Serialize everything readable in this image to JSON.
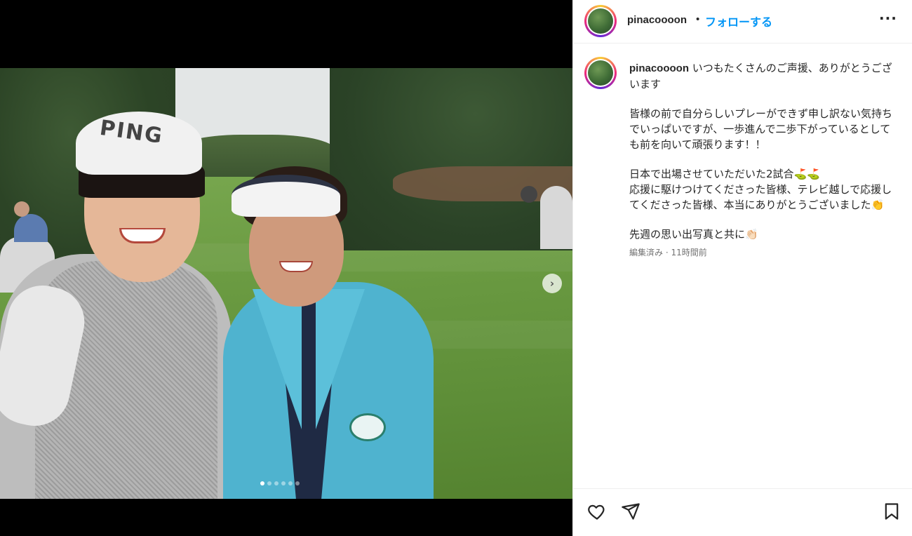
{
  "post": {
    "username": "pinacoooon",
    "separator": "•",
    "follow_label": "フォローする",
    "more_label": "···",
    "caption_first_line": "いつもたくさんのご声援、ありがとうございます",
    "caption_para2": "皆様の前で自分らしいプレーができず申し訳ない気持ちでいっぱいですが、一歩進んで二歩下がっているとしても前を向いて頑張ります！！",
    "caption_para3": "日本で出場させていただいた2試合⛳⛳\n応援に駆けつけてくださった皆様、テレビ越しで応援してくださった皆様、本当にありがとうございました👏",
    "caption_para4": "先週の思い出写真と共に👏🏻",
    "meta": "編集済み · 11時間前",
    "cap_text": "PING"
  },
  "carousel": {
    "current": 1,
    "total": 6
  },
  "icons": {
    "like": "heart-icon",
    "share": "send-icon",
    "save": "bookmark-icon",
    "next": "chevron-right-icon"
  },
  "colors": {
    "follow": "#0095f6",
    "meta": "#737373"
  }
}
